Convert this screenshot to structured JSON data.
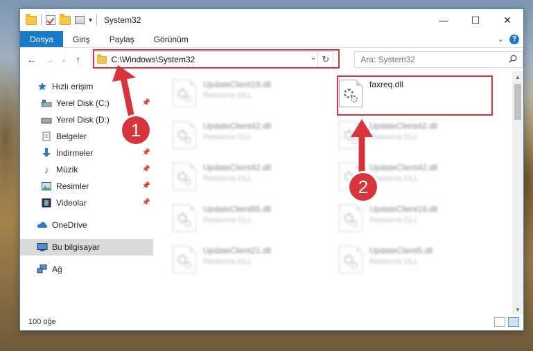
{
  "window": {
    "title": "System32"
  },
  "ribbon": {
    "tabs": [
      "Dosya",
      "Giriş",
      "Paylaş",
      "Görünüm"
    ]
  },
  "address": {
    "path": "C:\\Windows\\System32"
  },
  "search": {
    "placeholder": "Ara: System32"
  },
  "sidebar": {
    "quick_access": "Hızlı erişim",
    "items": [
      "Yerel Disk (C:)",
      "Yerel Disk (D:)",
      "Belgeler",
      "İndirmeler",
      "Müzik",
      "Resimler",
      "Videolar"
    ],
    "onedrive": "OneDrive",
    "this_pc": "Bu bilgisayar",
    "network": "Ağ"
  },
  "files": {
    "left": [
      {
        "name": "UpdateClient19.dll",
        "type": "Resource DLL"
      },
      {
        "name": "UpdateClient42.dll",
        "type": "Resource DLL"
      },
      {
        "name": "UpdateClient42.dll",
        "type": "Resource DLL"
      },
      {
        "name": "UpdateClient65.dll",
        "type": "Resource DLL"
      },
      {
        "name": "UpdateClient21.dll",
        "type": "Resource DLL"
      }
    ],
    "target": {
      "name": "faxreq.dll"
    },
    "right": [
      {
        "name": "UpdateClient42.dll",
        "type": "Resource DLL"
      },
      {
        "name": "UpdateClient42.dll",
        "type": "Resource DLL"
      },
      {
        "name": "UpdateClient19.dll",
        "type": "Resource DLL"
      },
      {
        "name": "UpdateClient5.dll",
        "type": "Resource DLL"
      }
    ]
  },
  "callouts": {
    "one": "1",
    "two": "2"
  },
  "status": {
    "count": "100 öğe"
  },
  "colors": {
    "accent": "#1979ca",
    "annotation": "#d8343c"
  }
}
